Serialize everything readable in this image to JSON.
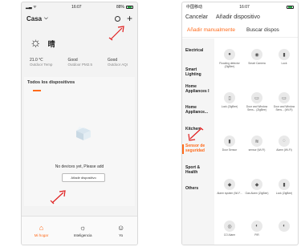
{
  "left": {
    "status": {
      "time": "16:07",
      "battery": "88%"
    },
    "header": {
      "title": "Casa",
      "caret": "⌵",
      "plus": "+"
    },
    "weather": {
      "icon": "☼",
      "condition": "晴",
      "stats": [
        {
          "value": "21.0 ℃",
          "label": "Outdoor Temp"
        },
        {
          "value": "Good",
          "label": "Outdoor PM2.5"
        },
        {
          "value": "Good",
          "label": "Outdoor AQI"
        }
      ]
    },
    "devices": {
      "title": "Todos los dispositivos",
      "empty_message": "No devices yet, Please add",
      "add_button": "Añadir dispositivo"
    },
    "tabbar": [
      {
        "icon": "⌂",
        "label": "Mi hogar",
        "active": true
      },
      {
        "icon": "☼",
        "label": "Inteligencia",
        "active": false
      },
      {
        "icon": "☺",
        "label": "Yo",
        "active": false
      }
    ]
  },
  "right": {
    "status": {
      "carrier": "中国移动",
      "time": "16:07"
    },
    "nav": {
      "cancel": "Cancelar",
      "title": "Añadir dispositivo"
    },
    "tabs": [
      {
        "label": "Añadir manualmente",
        "active": true
      },
      {
        "label": "Buscar dispos",
        "active": false
      }
    ],
    "categories": [
      {
        "label": "Electrical",
        "active": false
      },
      {
        "label": "Smart Lighting",
        "active": false
      },
      {
        "label": "Home Appliances I",
        "active": false
      },
      {
        "label": "Home Appliance...",
        "active": false
      },
      {
        "label": "Kitchen",
        "active": false
      },
      {
        "label": "Sensor de seguridad",
        "active": true
      },
      {
        "label": "Sport & Health",
        "active": false
      },
      {
        "label": "Others",
        "active": false
      }
    ],
    "devices": [
      {
        "label": "Flooding detector (ZigBee)",
        "icon": "●"
      },
      {
        "label": "Smart Camera",
        "icon": "◉"
      },
      {
        "label": "Lock",
        "icon": "▮"
      },
      {
        "label": "Lock (ZigBee)",
        "icon": "▯"
      },
      {
        "label": "Door and Window Sens... (ZigBee)",
        "icon": "▭"
      },
      {
        "label": "Door and Window Sens... (Wi-Fi)",
        "icon": "▭"
      },
      {
        "label": "Door Sensor",
        "icon": "▮"
      },
      {
        "label": "sensor (Wi-Fi)",
        "icon": "≋"
      },
      {
        "label": "Alarm (Wi-Fi)",
        "icon": "◌"
      },
      {
        "label": "Alarm system (Wi-F...",
        "icon": "◆"
      },
      {
        "label": "Gas Alarm (ZigBee)",
        "icon": "◆"
      },
      {
        "label": "Lock (ZigBee)",
        "icon": "▮"
      },
      {
        "label": "CO Alarm",
        "icon": "◎"
      },
      {
        "label": "PIR",
        "icon": "◐"
      },
      {
        "label": "",
        "icon": "◐"
      }
    ]
  },
  "colors": {
    "accent": "#ff6a1a",
    "annotation": "#e02020"
  }
}
